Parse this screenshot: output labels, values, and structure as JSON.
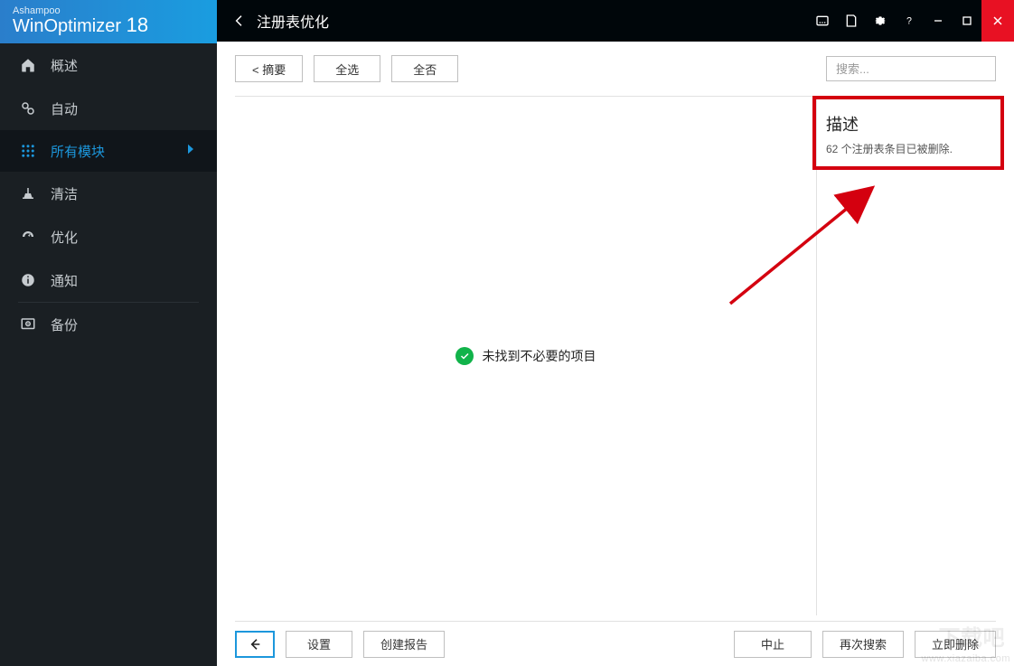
{
  "brand": {
    "subtitle": "Ashampoo",
    "title": "WinOptimizer ",
    "version": "18"
  },
  "titlebar": {
    "title": "注册表优化"
  },
  "sidebar": {
    "items": [
      {
        "label": "概述"
      },
      {
        "label": "自动"
      },
      {
        "label": "所有模块"
      },
      {
        "label": "清洁"
      },
      {
        "label": "优化"
      },
      {
        "label": "通知"
      },
      {
        "label": "备份"
      }
    ]
  },
  "toolbar": {
    "summary_label": "< 摘要",
    "select_all_label": "全选",
    "select_none_label": "全否",
    "search_placeholder": "搜索..."
  },
  "results": {
    "no_items_label": "未找到不必要的项目"
  },
  "desc": {
    "heading": "描述",
    "text": "62 个注册表条目已被删除."
  },
  "bottom": {
    "settings_label": "设置",
    "report_label": "创建报告",
    "abort_label": "中止",
    "rescan_label": "再次搜索",
    "delete_label": "立即删除"
  },
  "watermark": {
    "site": "www.xiazaiba.com",
    "brand": "下载吧"
  }
}
